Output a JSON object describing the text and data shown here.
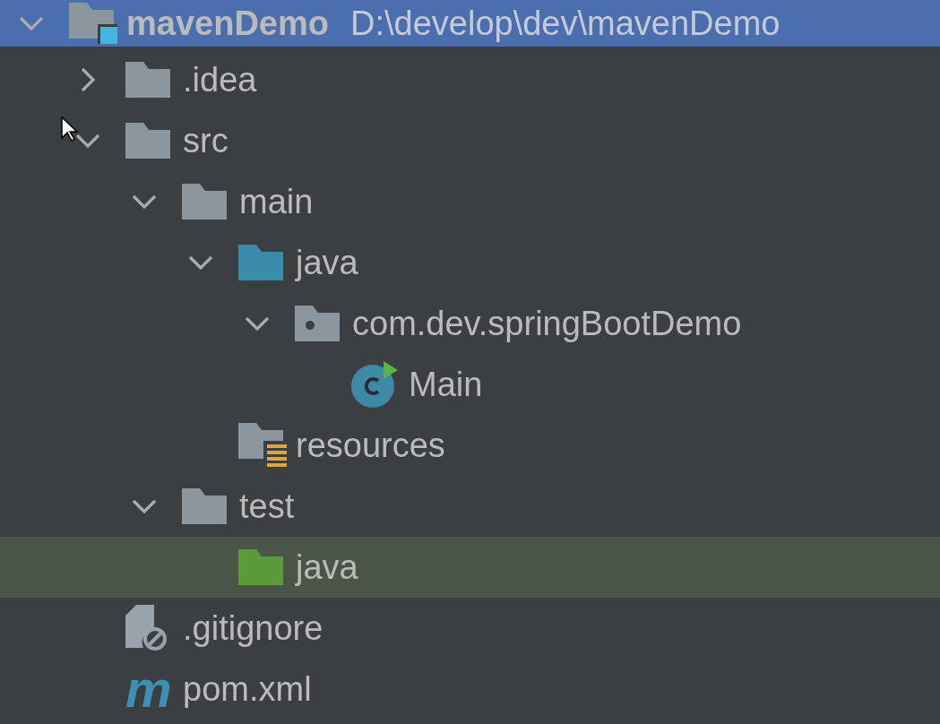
{
  "tree": [
    {
      "label": "mavenDemo",
      "path": "D:\\develop\\dev\\mavenDemo",
      "kind": "project",
      "expanded": true,
      "selected": true,
      "highlighted": false,
      "children": [
        {
          "label": ".idea",
          "kind": "folder",
          "expanded": false,
          "selected": false,
          "highlighted": false
        },
        {
          "label": "src",
          "kind": "folder",
          "expanded": true,
          "selected": false,
          "highlighted": false,
          "children": [
            {
              "label": "main",
              "kind": "folder",
              "expanded": true,
              "selected": false,
              "highlighted": false,
              "children": [
                {
                  "label": "java",
                  "kind": "source",
                  "expanded": true,
                  "selected": false,
                  "highlighted": false,
                  "children": [
                    {
                      "label": "com.dev.springBootDemo",
                      "kind": "package",
                      "expanded": true,
                      "selected": false,
                      "highlighted": false,
                      "children": [
                        {
                          "label": "Main",
                          "kind": "class",
                          "selected": false,
                          "highlighted": false
                        }
                      ]
                    }
                  ]
                },
                {
                  "label": "resources",
                  "kind": "resources",
                  "selected": false,
                  "highlighted": false
                }
              ]
            },
            {
              "label": "test",
              "kind": "folder",
              "expanded": true,
              "selected": false,
              "highlighted": false,
              "children": [
                {
                  "label": "java",
                  "kind": "test",
                  "selected": false,
                  "highlighted": true
                }
              ]
            }
          ]
        },
        {
          "label": ".gitignore",
          "kind": "gitignore",
          "selected": false,
          "highlighted": false
        },
        {
          "label": "pom.xml",
          "kind": "maven",
          "icon_text": "m",
          "selected": false,
          "highlighted": false
        }
      ]
    }
  ]
}
